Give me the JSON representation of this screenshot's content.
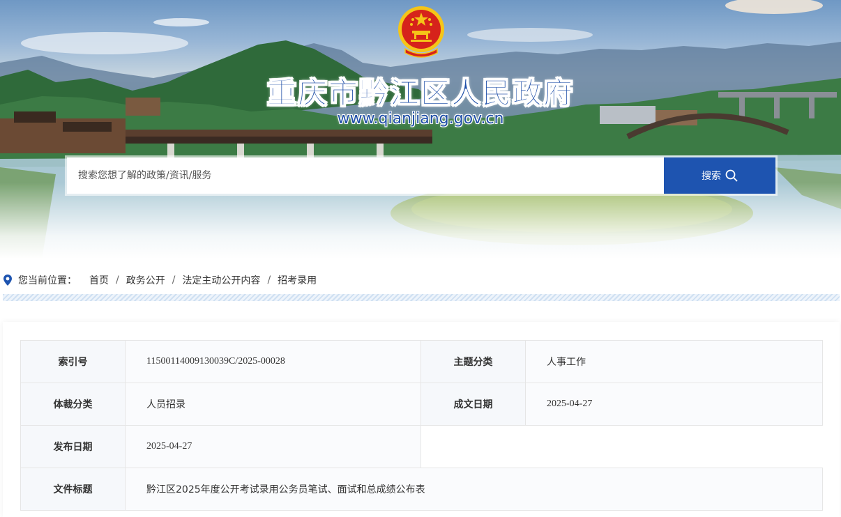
{
  "header": {
    "title": "重庆市黔江区人民政府",
    "url": "www.qianjiang.gov.cn"
  },
  "search": {
    "placeholder": "搜索您想了解的政策/资讯/服务",
    "button_label": "搜索"
  },
  "breadcrumb": {
    "lead": "您当前位置：",
    "items": [
      "首页",
      "政务公开",
      "法定主动公开内容",
      "招考录用"
    ],
    "separator": "/"
  },
  "meta": {
    "index_label": "索引号",
    "index_value": "11500114009130039C/2025-00028",
    "topic_label": "主题分类",
    "topic_value": "人事工作",
    "genre_label": "体裁分类",
    "genre_value": "人员招录",
    "written_label": "成文日期",
    "written_value": "2025-04-27",
    "publish_label": "发布日期",
    "publish_value": "2025-04-27",
    "doc_title_label": "文件标题",
    "doc_title_value": "黔江区2025年度公开考试录用公务员笔试、面试和总成绩公布表"
  },
  "colors": {
    "brand_blue": "#1e54b0",
    "emblem_red": "#d6231b",
    "emblem_gold": "#f5c518"
  }
}
